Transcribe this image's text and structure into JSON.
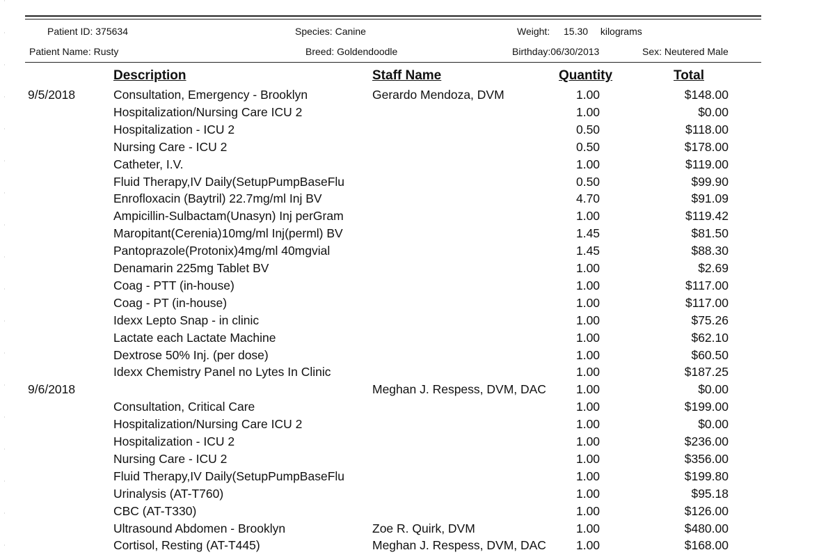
{
  "patient": {
    "id_label": "Patient ID:",
    "id_value": "375634",
    "species_label": "Species:",
    "species_value": "Canine",
    "weight_label": "Weight:",
    "weight_value": "15.30",
    "weight_unit": "kilograms",
    "name_label": "Patient Name:",
    "name_value": "Rusty",
    "breed_label": "Breed:",
    "breed_value": "Goldendoodle",
    "birthday_label": "Birthday:",
    "birthday_value": "06/30/2013",
    "sex_label": "Sex:",
    "sex_value": "Neutered Male"
  },
  "columns": {
    "description": "Description",
    "staff": "Staff Name",
    "quantity": "Quantity",
    "total": "Total"
  },
  "rows": [
    {
      "date": "9/5/2018",
      "desc": "Consultation, Emergency - Brooklyn",
      "staff": "Gerardo Mendoza, DVM",
      "qty": "1.00",
      "total": "$148.00"
    },
    {
      "date": "",
      "desc": "Hospitalization/Nursing Care ICU 2",
      "staff": "",
      "qty": "1.00",
      "total": "$0.00"
    },
    {
      "date": "",
      "desc": "Hospitalization - ICU 2",
      "staff": "",
      "qty": "0.50",
      "total": "$118.00"
    },
    {
      "date": "",
      "desc": "Nursing Care - ICU 2",
      "staff": "",
      "qty": "0.50",
      "total": "$178.00"
    },
    {
      "date": "",
      "desc": "Catheter, I.V.",
      "staff": "",
      "qty": "1.00",
      "total": "$119.00"
    },
    {
      "date": "",
      "desc": "Fluid Therapy,IV Daily(SetupPumpBaseFlu",
      "staff": "",
      "qty": "0.50",
      "total": "$99.90"
    },
    {
      "date": "",
      "desc": "Enrofloxacin (Baytril) 22.7mg/ml Inj BV",
      "staff": "",
      "qty": "4.70",
      "total": "$91.09"
    },
    {
      "date": "",
      "desc": "Ampicillin-Sulbactam(Unasyn) Inj perGram",
      "staff": "",
      "qty": "1.00",
      "total": "$119.42"
    },
    {
      "date": "",
      "desc": "Maropitant(Cerenia)10mg/ml Inj(perml) BV",
      "staff": "",
      "qty": "1.45",
      "total": "$81.50"
    },
    {
      "date": "",
      "desc": "Pantoprazole(Protonix)4mg/ml 40mgvial",
      "staff": "",
      "qty": "1.45",
      "total": "$88.30"
    },
    {
      "date": "",
      "desc": "Denamarin 225mg Tablet BV",
      "staff": "",
      "qty": "1.00",
      "total": "$2.69"
    },
    {
      "date": "",
      "desc": "Coag -  PTT  (in-house)",
      "staff": "",
      "qty": "1.00",
      "total": "$117.00"
    },
    {
      "date": "",
      "desc": "Coag -  PT  (in-house)",
      "staff": "",
      "qty": "1.00",
      "total": "$117.00"
    },
    {
      "date": "",
      "desc": "Idexx Lepto Snap - in clinic",
      "staff": "",
      "qty": "1.00",
      "total": "$75.26"
    },
    {
      "date": "",
      "desc": "Lactate each Lactate Machine",
      "staff": "",
      "qty": "1.00",
      "total": "$62.10"
    },
    {
      "date": "",
      "desc": "Dextrose 50% Inj. (per dose)",
      "staff": "",
      "qty": "1.00",
      "total": "$60.50"
    },
    {
      "date": "",
      "desc": "Idexx Chemistry Panel no Lytes In Clinic",
      "staff": "",
      "qty": "1.00",
      "total": "$187.25"
    },
    {
      "date": "9/6/2018",
      "desc": "",
      "staff": "Meghan J. Respess, DVM, DACVECC",
      "qty": "1.00",
      "total": "$0.00"
    },
    {
      "date": "",
      "desc": "Consultation, Critical Care",
      "staff": "",
      "qty": "1.00",
      "total": "$199.00"
    },
    {
      "date": "",
      "desc": "Hospitalization/Nursing Care ICU 2",
      "staff": "",
      "qty": "1.00",
      "total": "$0.00"
    },
    {
      "date": "",
      "desc": "Hospitalization - ICU 2",
      "staff": "",
      "qty": "1.00",
      "total": "$236.00"
    },
    {
      "date": "",
      "desc": "Nursing Care - ICU 2",
      "staff": "",
      "qty": "1.00",
      "total": "$356.00"
    },
    {
      "date": "",
      "desc": "Fluid Therapy,IV Daily(SetupPumpBaseFlu",
      "staff": "",
      "qty": "1.00",
      "total": "$199.80"
    },
    {
      "date": "",
      "desc": "Urinalysis (AT-T760)",
      "staff": "",
      "qty": "1.00",
      "total": "$95.18"
    },
    {
      "date": "",
      "desc": "CBC (AT-T330)",
      "staff": "",
      "qty": "1.00",
      "total": "$126.00"
    },
    {
      "date": "",
      "desc": "Ultrasound Abdomen - Brooklyn",
      "staff": "Zoe R. Quirk, DVM",
      "qty": "1.00",
      "total": "$480.00"
    },
    {
      "date": "",
      "desc": "Cortisol, Resting (AT-T445)",
      "staff": "Meghan J. Respess, DVM, DACVECC",
      "qty": "1.00",
      "total": "$168.00"
    }
  ]
}
